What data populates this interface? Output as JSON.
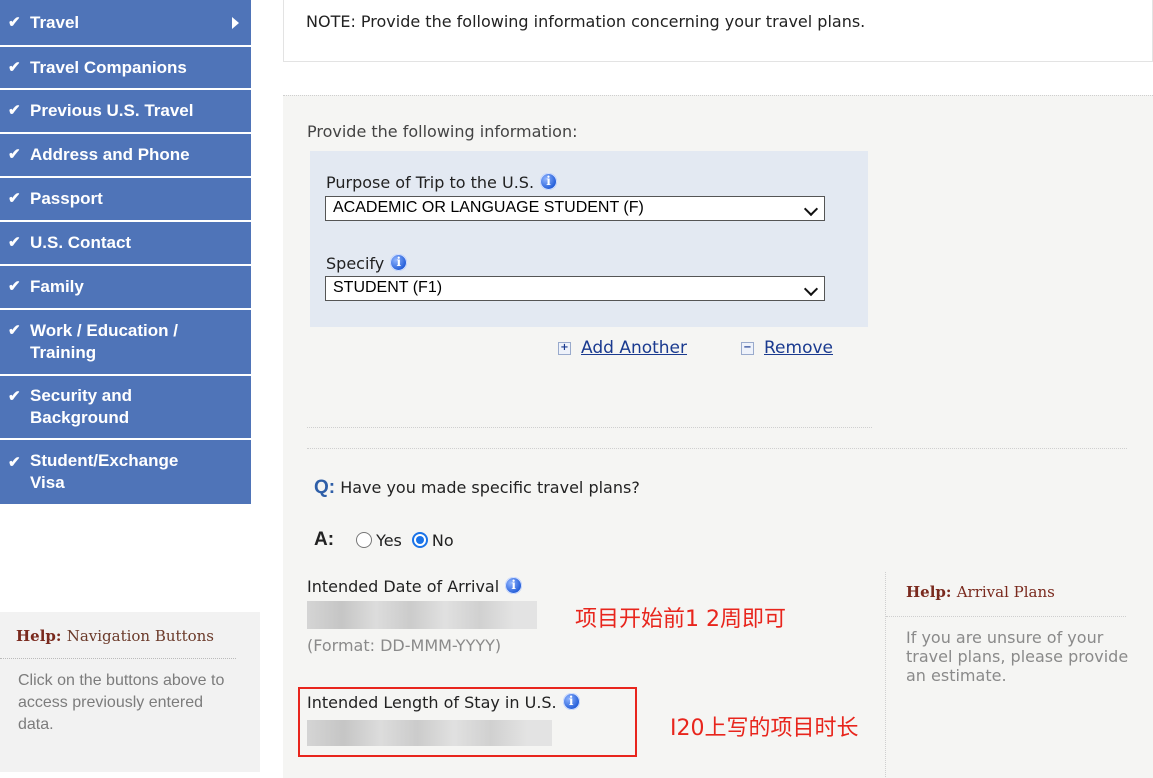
{
  "sidebar": {
    "items": [
      {
        "label": "Travel",
        "has_arrow": true
      },
      {
        "label": "Travel Companions"
      },
      {
        "label": "Previous U.S. Travel"
      },
      {
        "label": "Address and Phone"
      },
      {
        "label": "Passport"
      },
      {
        "label": "U.S. Contact"
      },
      {
        "label": "Family"
      },
      {
        "label": "Work / Education / Training"
      },
      {
        "label": "Security and Background"
      },
      {
        "label": "Student/Exchange Visa"
      }
    ],
    "check_glyph": "✔"
  },
  "help_nav": {
    "title_prefix": "Help:",
    "title": "Navigation Buttons",
    "text": "Click on the buttons above to access previously entered data."
  },
  "note": "NOTE: Provide the following information concerning your travel plans.",
  "form": {
    "provide_label": "Provide the following information:",
    "purpose_label": "Purpose of Trip to the U.S.",
    "purpose_value": "ACADEMIC OR LANGUAGE STUDENT (F)",
    "specify_label": "Specify",
    "specify_value": "STUDENT (F1)",
    "add_another": "Add Another",
    "remove": "Remove",
    "plus_glyph": "+",
    "minus_glyph": "−",
    "question_letter": "Q:",
    "question": "Have you made specific travel plans?",
    "answer_letter": "A:",
    "yes_label": "Yes",
    "no_label": "No",
    "selected": "No",
    "arrival_label": "Intended Date of Arrival",
    "arrival_format": "(Format: DD-MMM-YYYY)",
    "length_label": "Intended Length of Stay in U.S.",
    "info_glyph": "i"
  },
  "annotations": {
    "arrival_note": "项目开始前1 2周即可",
    "length_note": "I20上写的项目时长",
    "color": "#e8251c"
  },
  "help_arrival": {
    "title_prefix": "Help:",
    "title": "Arrival Plans",
    "text": "If you are unsure of your travel plans, please provide an estimate."
  },
  "colors": {
    "nav_bg": "#4f74b8",
    "panel_bg": "#f5f5f3",
    "select_box_bg": "#e3e9f2",
    "link": "#1a3a8f",
    "help_title": "#7a2a1e"
  }
}
